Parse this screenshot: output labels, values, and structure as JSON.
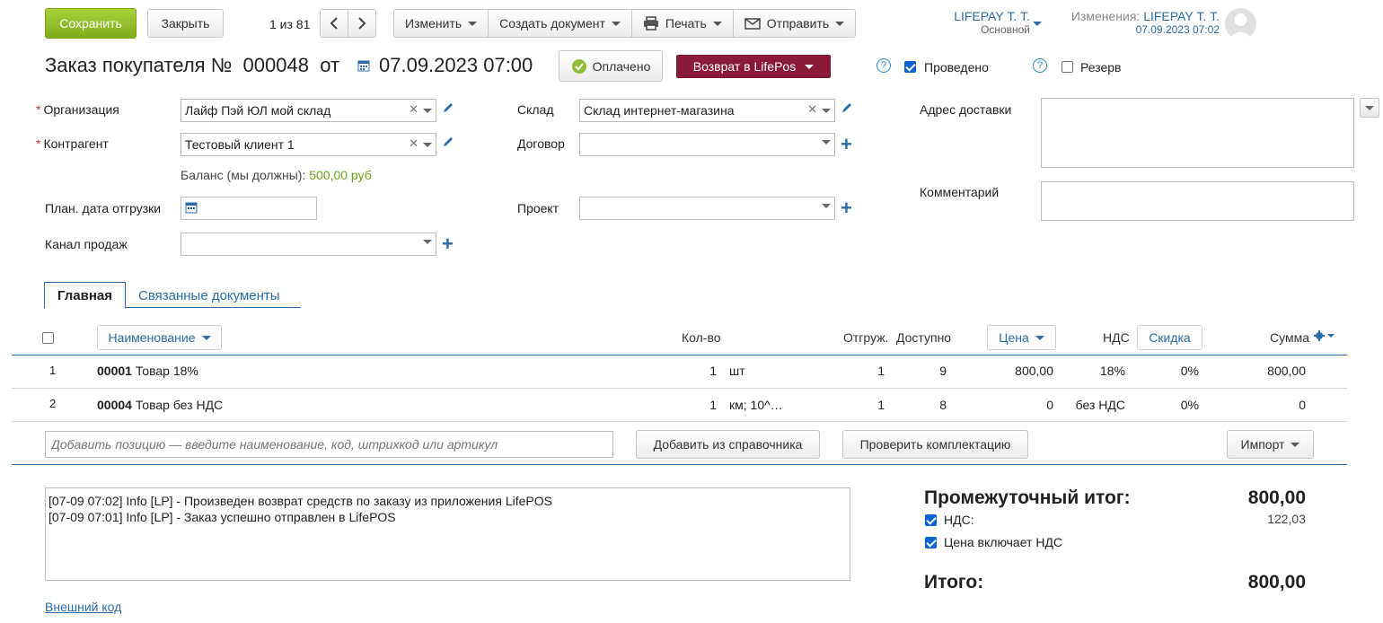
{
  "toolbar": {
    "save": "Сохранить",
    "close": "Закрыть",
    "pager": "1 из 81",
    "prev_icon": "chevron-left-icon",
    "next_icon": "chevron-right-icon",
    "edit": "Изменить",
    "create_doc": "Создать документ",
    "print": "Печать",
    "send": "Отправить"
  },
  "user": {
    "name": "LIFEPAY Т. Т.",
    "role": "Основной",
    "changes_label": "Изменения:",
    "changes_user": "LIFEPAY Т. Т.",
    "changes_time": "07.09.2023 07:02"
  },
  "header": {
    "title": "Заказ покупателя №",
    "number": "000048",
    "from": "от",
    "datetime": "07.09.2023 07:00",
    "paid": "Оплачено",
    "return_btn": "Возврат в LifePos",
    "posted_label": "Проведено",
    "posted_checked": true,
    "reserve_label": "Резерв",
    "reserve_checked": false,
    "help_glyph": "?"
  },
  "form": {
    "org_label": "Организация",
    "org_value": "Лайф Пэй ЮЛ мой склад",
    "contractor_label": "Контрагент",
    "contractor_value": "Тестовый клиент 1",
    "balance_label": "Баланс (мы должны):",
    "balance_value": "500,00 руб",
    "ship_date_label": "План. дата отгрузки",
    "channel_label": "Канал продаж",
    "warehouse_label": "Склад",
    "warehouse_value": "Склад интернет-магазина",
    "contract_label": "Договор",
    "project_label": "Проект",
    "address_label": "Адрес доставки",
    "comment_label": "Комментарий"
  },
  "tabs": [
    "Главная",
    "Связанные документы"
  ],
  "table": {
    "columns": {
      "name": "Наименование",
      "qty": "Кол-во",
      "shipped": "Отгруж.",
      "available": "Доступно",
      "price": "Цена",
      "vat": "НДС",
      "discount": "Скидка",
      "sum": "Сумма"
    },
    "rows": [
      {
        "n": "1",
        "code": "00001",
        "name": "Товар 18%",
        "qty": "1",
        "unit": "шт",
        "shipped": "1",
        "available": "9",
        "price": "800,00",
        "vat": "18%",
        "discount": "0%",
        "sum": "800,00"
      },
      {
        "n": "2",
        "code": "00004",
        "name": "Товар без НДС",
        "qty": "1",
        "unit": "км; 10^…",
        "shipped": "1",
        "available": "8",
        "price": "0",
        "vat": "без НДС",
        "discount": "0%",
        "sum": "0"
      }
    ],
    "add_placeholder": "Добавить позицию — введите наименование, код, штрихкод или артикул",
    "add_from_catalog": "Добавить из справочника",
    "check_bundle": "Проверить комплектацию",
    "import": "Импорт"
  },
  "log": "[07-09 07:02] Info [LP] - Произведен возврат средств по заказу из приложения LifePOS\n[07-09 07:01] Info [LP] - Заказ успешно отправлен в LifePOS",
  "external_code": "Внешний код",
  "totals": {
    "subtotal_label": "Промежуточный итог:",
    "subtotal_value": "800,00",
    "vat_label": "НДС:",
    "vat_value": "122,03",
    "price_incl_vat_label": "Цена включает НДС",
    "total_label": "Итого:",
    "total_value": "800,00"
  },
  "colors": {
    "save_green": "#8cbf26",
    "return_red": "#8b1a3a",
    "link_blue": "#2a6ca8",
    "balance_green": "#6aa51a"
  }
}
